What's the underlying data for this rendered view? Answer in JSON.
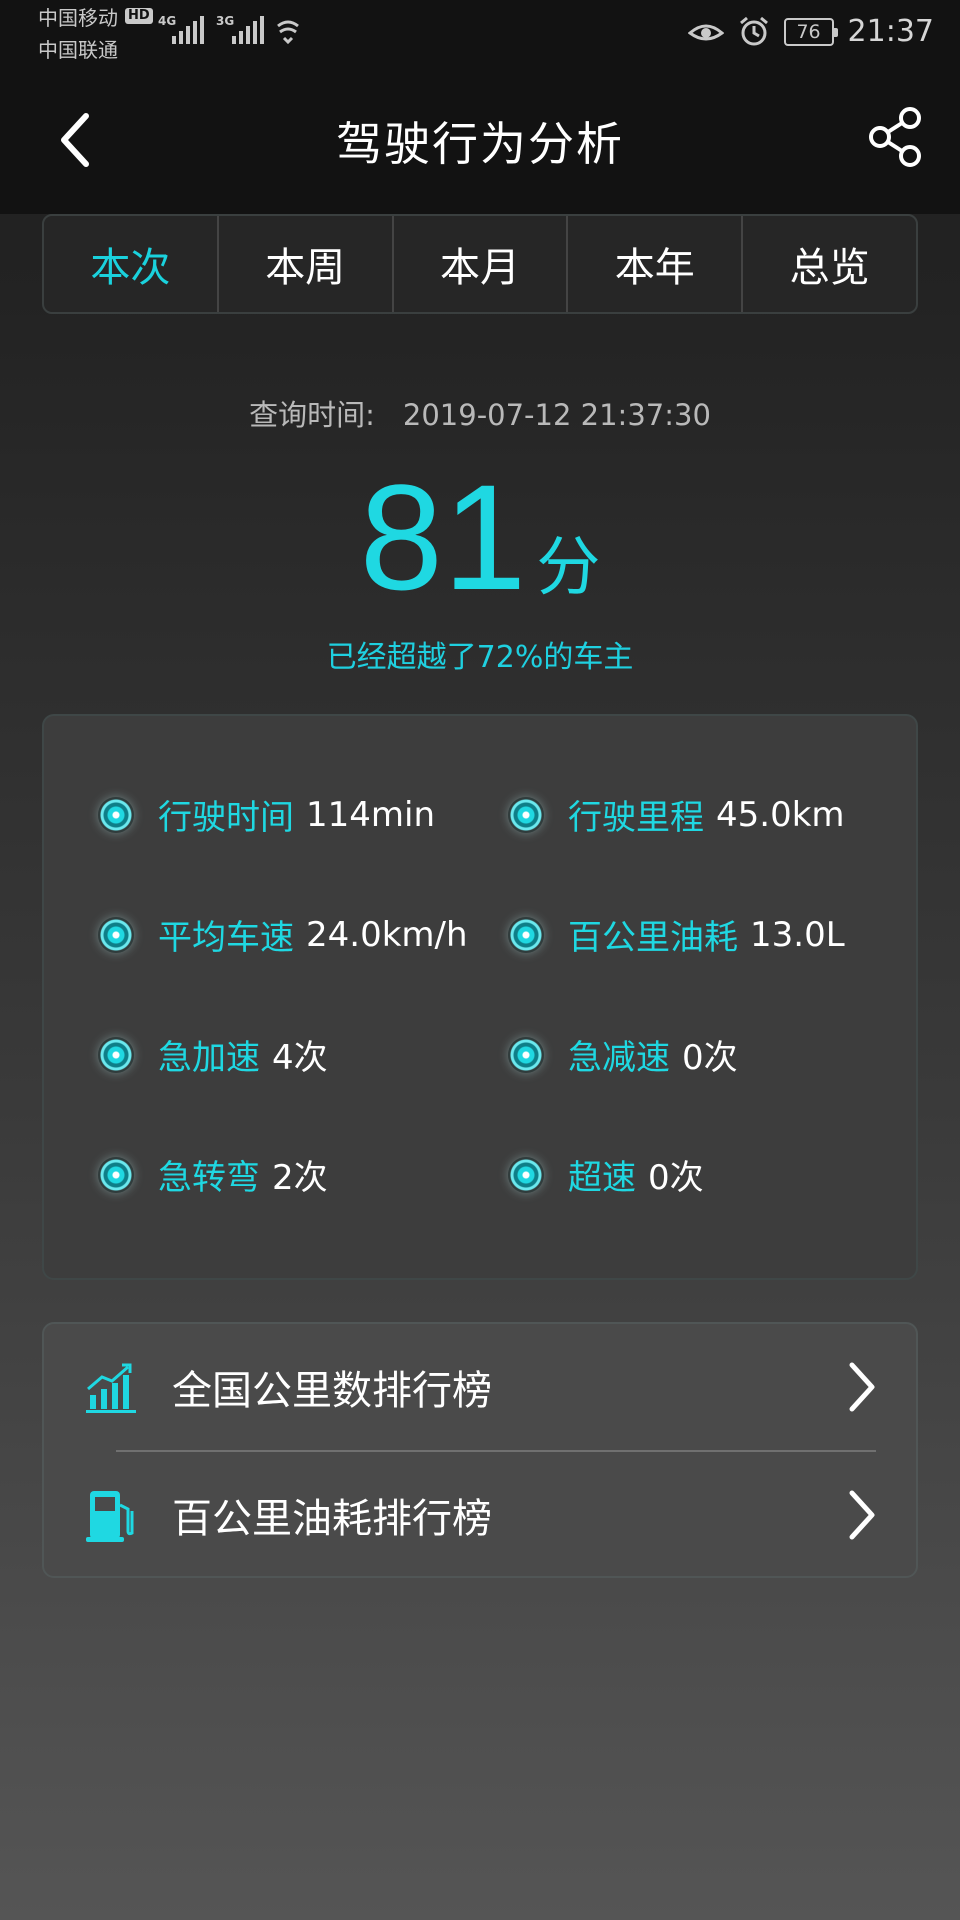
{
  "status_bar": {
    "carrier1": "中国移动",
    "carrier2": "中国联通",
    "hd": "HD",
    "net1": "4G",
    "net2": "3G",
    "battery": "76",
    "time": "21:37"
  },
  "header": {
    "title": "驾驶行为分析"
  },
  "tabs": [
    "本次",
    "本周",
    "本月",
    "本年",
    "总览"
  ],
  "active_tab": 0,
  "summary": {
    "query_label": "查询时间:",
    "query_time": "2019-07-12 21:37:30",
    "score": "81",
    "score_unit": "分",
    "beat_text": "已经超越了72%的车主"
  },
  "stats": [
    {
      "label": "行驶时间",
      "value": "114min"
    },
    {
      "label": "行驶里程",
      "value": "45.0km"
    },
    {
      "label": "平均车速",
      "value": "24.0km/h"
    },
    {
      "label": "百公里油耗",
      "value": "13.0L"
    },
    {
      "label": "急加速",
      "value": "4次"
    },
    {
      "label": "急减速",
      "value": "0次"
    },
    {
      "label": "急转弯",
      "value": "2次"
    },
    {
      "label": "超速",
      "value": "0次"
    }
  ],
  "rankings": [
    {
      "label": "全国公里数排行榜",
      "icon": "bar-chart-icon"
    },
    {
      "label": "百公里油耗排行榜",
      "icon": "fuel-pump-icon"
    }
  ],
  "colors": {
    "accent": "#1fd8e2",
    "bar_bg": "#121212"
  }
}
